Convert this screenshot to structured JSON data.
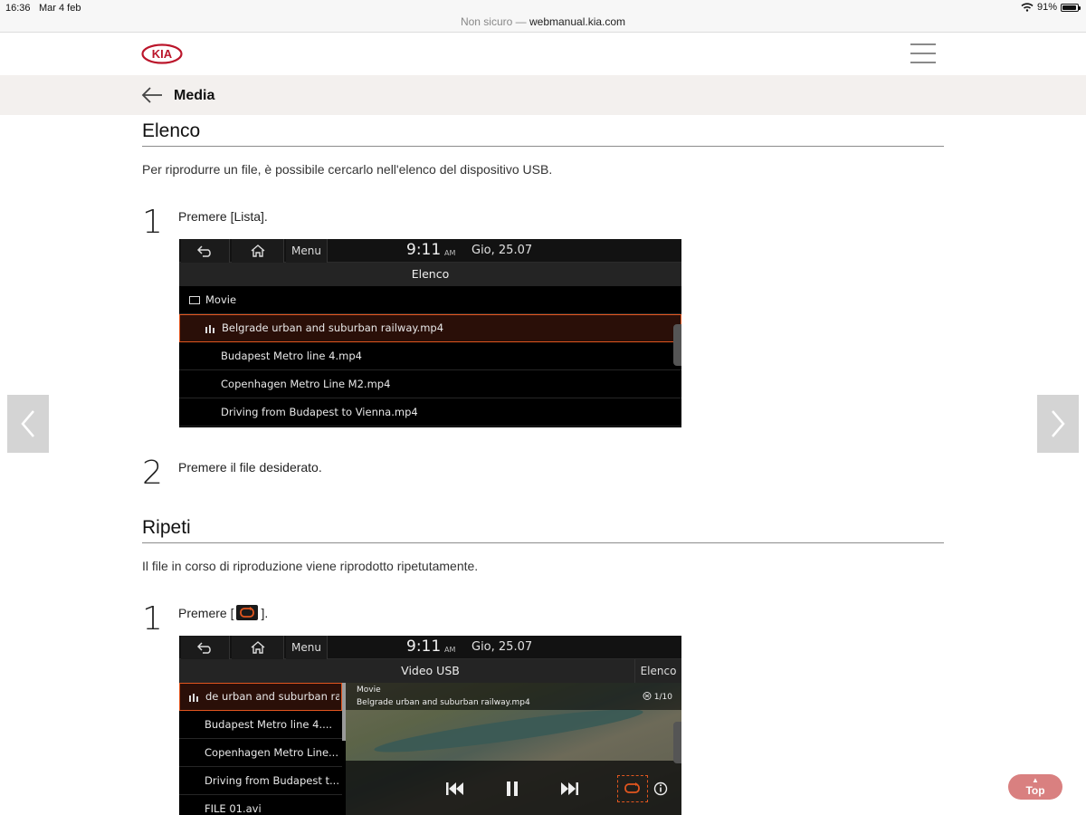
{
  "status_bar": {
    "time": "16:36",
    "date": "Mar 4 feb",
    "battery": "91%",
    "battery_level": 0.91
  },
  "browser": {
    "security": "Non sicuro —",
    "host": "webmanual.kia.com"
  },
  "header": {
    "logo": "KIA",
    "section_title": "Media"
  },
  "sections": [
    {
      "title": "Elenco",
      "description": "Per riprodurre un file, è possibile cercarlo nell'elenco del dispositivo USB.",
      "steps": [
        {
          "num": "1",
          "text": "Premere [Lista]."
        },
        {
          "num": "2",
          "text": "Premere il file desiderato."
        }
      ]
    },
    {
      "title": "Ripeti",
      "description": "Il file in corso di riproduzione viene riprodotto ripetutamente.",
      "steps": [
        {
          "num": "1",
          "text_before": "Premere [",
          "text_after": "]."
        }
      ]
    }
  ],
  "screen1": {
    "menu": "Menu",
    "time": "9:11",
    "ampm": "AM",
    "date": "Gio, 25.07",
    "title": "Elenco",
    "folder": "Movie",
    "files": [
      "Belgrade urban and suburban railway.mp4",
      "Budapest Metro line 4.mp4",
      "Copenhagen Metro Line M2.mp4",
      "Driving from Budapest to Vienna.mp4"
    ]
  },
  "screen2": {
    "menu": "Menu",
    "time": "9:11",
    "ampm": "AM",
    "date": "Gio, 25.07",
    "title": "Video USB",
    "list_button": "Elenco",
    "files": [
      "de urban and suburban ra",
      "Budapest Metro line 4....",
      "Copenhagen Metro Line...",
      "Driving from Budapest t...",
      "FILE 01.avi"
    ],
    "folder": "Movie",
    "now_playing": "Belgrade urban and suburban railway.mp4",
    "counter": "1/10"
  },
  "top_button": "Top",
  "colors": {
    "accent": "#e2561f",
    "kia_red": "#bb162b",
    "top_button": "#d98080"
  }
}
